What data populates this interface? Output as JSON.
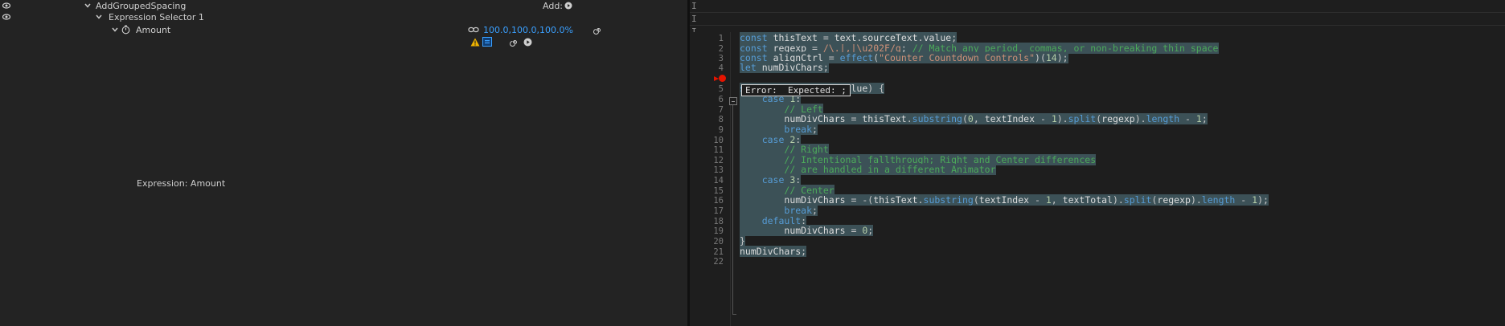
{
  "timeline": {
    "rows": [
      {
        "label": "AddGroupedSpacing",
        "add_label": "Add:"
      },
      {
        "label": "Expression Selector 1"
      },
      {
        "label": "Amount",
        "value": "100.0,100.0,100.0%"
      }
    ],
    "expression_label": "Expression: Amount"
  },
  "editor": {
    "lines": [
      {
        "n": "1",
        "html": "<span class='kw'>const</span> <span class='vr'>thisText</span> = <span class='vr'>text</span>.<span class='vr'>sourceText</span>.<span class='vr'>value</span>;"
      },
      {
        "n": "2",
        "html": "<span class='kw'>const</span> <span class='vr'>regexp</span> = <span class='str'>/\\.|,|\\u202F/g</span>; <span class='cm'>// Match any period, commas, or non-breaking thin space</span>"
      },
      {
        "n": "3",
        "html": "<span class='kw'>const</span> <span class='vr'>alignCtrl</span> = <span class='fn'>effect</span>(<span class='str'>\"Counter Countdown Controls\"</span>)(<span class='num'>14</span>);"
      },
      {
        "n": "4",
        "html": "<span class='kw'>let</span> <span class='vr'>numDivChars</span>;"
      },
      {
        "n": "5",
        "html": "<span class='kw'>switch</span> (<span class='vr'>alignCtrl</span>.<span class='vr'>value</span>) {"
      },
      {
        "n": "6",
        "html": "    <span class='kw'>case</span> <span class='num'>1</span>:"
      },
      {
        "n": "7",
        "html": "        <span class='cm'>// Left</span>"
      },
      {
        "n": "8",
        "html": "        <span class='vr'>numDivChars</span> = <span class='vr'>thisText</span>.<span class='fn'>substring</span>(<span class='num'>0</span>, <span class='vr'>textIndex</span> - <span class='num'>1</span>).<span class='fn'>split</span>(<span class='vr'>regexp</span>).<span class='fn'>length</span> - <span class='num'>1</span>;"
      },
      {
        "n": "9",
        "html": "        <span class='kw'>break</span>;"
      },
      {
        "n": "10",
        "html": "    <span class='kw'>case</span> <span class='num'>2</span>:"
      },
      {
        "n": "11",
        "html": "        <span class='cm'>// Right</span>"
      },
      {
        "n": "12",
        "html": "        <span class='cm'>// Intentional fallthrough; Right and Center differences</span>"
      },
      {
        "n": "13",
        "html": "        <span class='cm'>// are handled in a different Animator</span>"
      },
      {
        "n": "14",
        "html": "    <span class='kw'>case</span> <span class='num'>3</span>:"
      },
      {
        "n": "15",
        "html": "        <span class='cm'>// Center</span>"
      },
      {
        "n": "16",
        "html": "        <span class='vr'>numDivChars</span> = -(<span class='vr'>thisText</span>.<span class='fn'>substring</span>(<span class='vr'>textIndex</span> - <span class='num'>1</span>, <span class='vr'>textTotal</span>).<span class='fn'>split</span>(<span class='vr'>regexp</span>).<span class='fn'>length</span> - <span class='num'>1</span>);"
      },
      {
        "n": "17",
        "html": "        <span class='kw'>break</span>;"
      },
      {
        "n": "18",
        "html": "    <span class='kw'>default</span>:"
      },
      {
        "n": "19",
        "html": "        <span class='vr'>numDivChars</span> = <span class='num'>0</span>;"
      },
      {
        "n": "20",
        "html": "}"
      },
      {
        "n": "21",
        "html": "<span class='vr'>numDivChars</span>;"
      },
      {
        "n": "22",
        "html": ""
      }
    ],
    "error_text": "Error:  Expected: ;"
  },
  "icons": {
    "eye": "eye-icon",
    "twirl": "chevron-down-icon",
    "stopwatch": "stopwatch-icon",
    "link": "link-icon",
    "spiral": "spiral-icon",
    "warning": "warning-icon",
    "equals": "equals-icon",
    "graph": "graph-icon",
    "play": "play-icon",
    "breakpoint": "breakpoint-icon"
  },
  "colors": {
    "selection": "#3c5157",
    "value_blue": "#3aa0ff",
    "error_red": "#e51400",
    "warning_yellow": "#f0b400"
  }
}
